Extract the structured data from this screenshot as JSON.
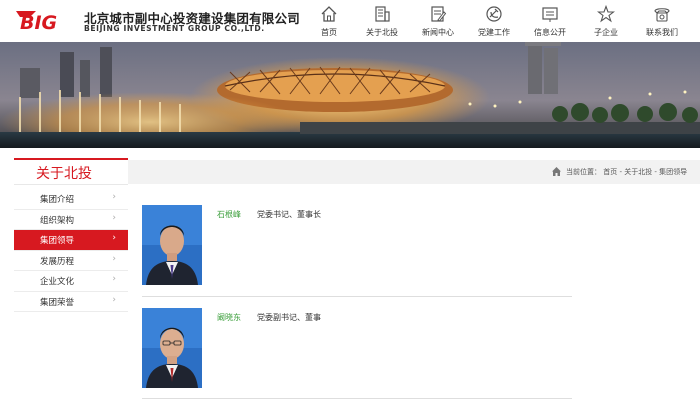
{
  "brand": {
    "logo_text": "BIG",
    "name_cn": "北京城市副中心投资建设集团有限公司",
    "name_en": "BEIJING INVESTMENT GROUP CO.,LTD.",
    "accent_color": "#d71920"
  },
  "nav": {
    "items": [
      {
        "label": "首页",
        "icon": "home-icon"
      },
      {
        "label": "关于北投",
        "icon": "building-icon"
      },
      {
        "label": "新闻中心",
        "icon": "news-icon"
      },
      {
        "label": "党建工作",
        "icon": "party-emblem-icon"
      },
      {
        "label": "信息公开",
        "icon": "info-board-icon"
      },
      {
        "label": "子企业",
        "icon": "star-icon"
      },
      {
        "label": "联系我们",
        "icon": "phone-icon"
      }
    ]
  },
  "sidebar": {
    "title": "关于北投",
    "items": [
      {
        "label": "集团介绍",
        "arrow": "›",
        "active": false
      },
      {
        "label": "组织架构",
        "arrow": "›",
        "active": false
      },
      {
        "label": "集团领导",
        "arrow": "›",
        "active": true
      },
      {
        "label": "发展历程",
        "arrow": "›",
        "active": false
      },
      {
        "label": "企业文化",
        "arrow": "›",
        "active": false
      },
      {
        "label": "集团荣誉",
        "arrow": "›",
        "active": false
      }
    ]
  },
  "breadcrumb": {
    "prefix": "当前位置：",
    "path": "首页 - 关于北投 - 集团领导"
  },
  "leaders": [
    {
      "name": "石根峰",
      "title": "党委书记、董事长"
    },
    {
      "name": "阚晓东",
      "title": "党委副书记、董事"
    }
  ]
}
